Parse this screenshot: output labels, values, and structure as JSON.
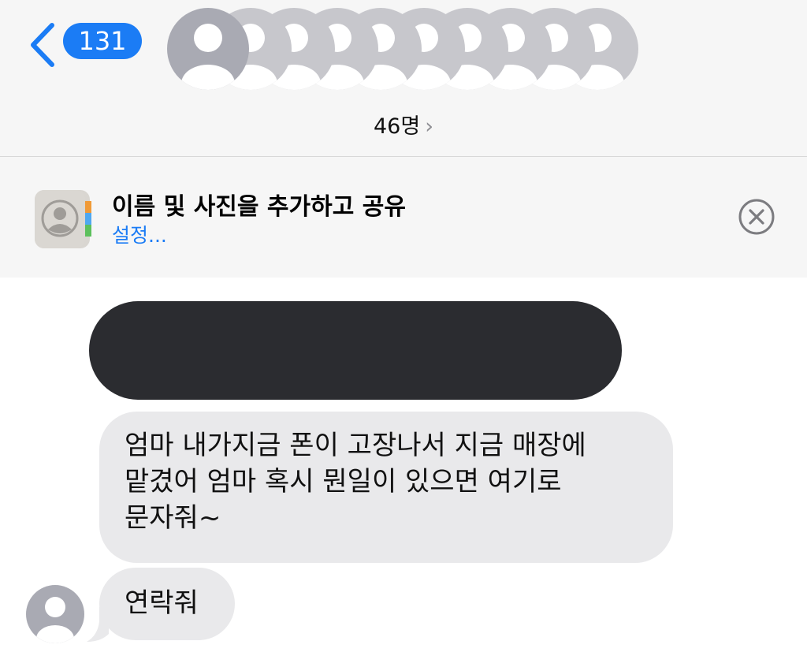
{
  "header": {
    "back_count": "131",
    "member_count": "46명",
    "member_chevron": "›"
  },
  "banner": {
    "title": "이름 및 사진을 추가하고 공유",
    "link": "설정..."
  },
  "messages": [
    {
      "type": "redacted",
      "direction": "incoming"
    },
    {
      "type": "text",
      "direction": "incoming",
      "lines": [
        "엄마 내가지금 폰이 고장나서 지금 매장에",
        "맡겼어 엄마 혹시 뭔일이 있으면 여기로",
        "문자줘~"
      ]
    },
    {
      "type": "text",
      "direction": "incoming",
      "text": "연락줘"
    }
  ],
  "icons": {
    "back": "chevron-left-icon",
    "avatar": "person-placeholder-icon",
    "contacts": "contacts-app-icon",
    "close": "close-circle-icon"
  },
  "colors": {
    "accent": "#1b7cf5",
    "bubble": "#e9e9eb",
    "redacted": "#2b2c30",
    "avatar": "#a9aab3"
  }
}
